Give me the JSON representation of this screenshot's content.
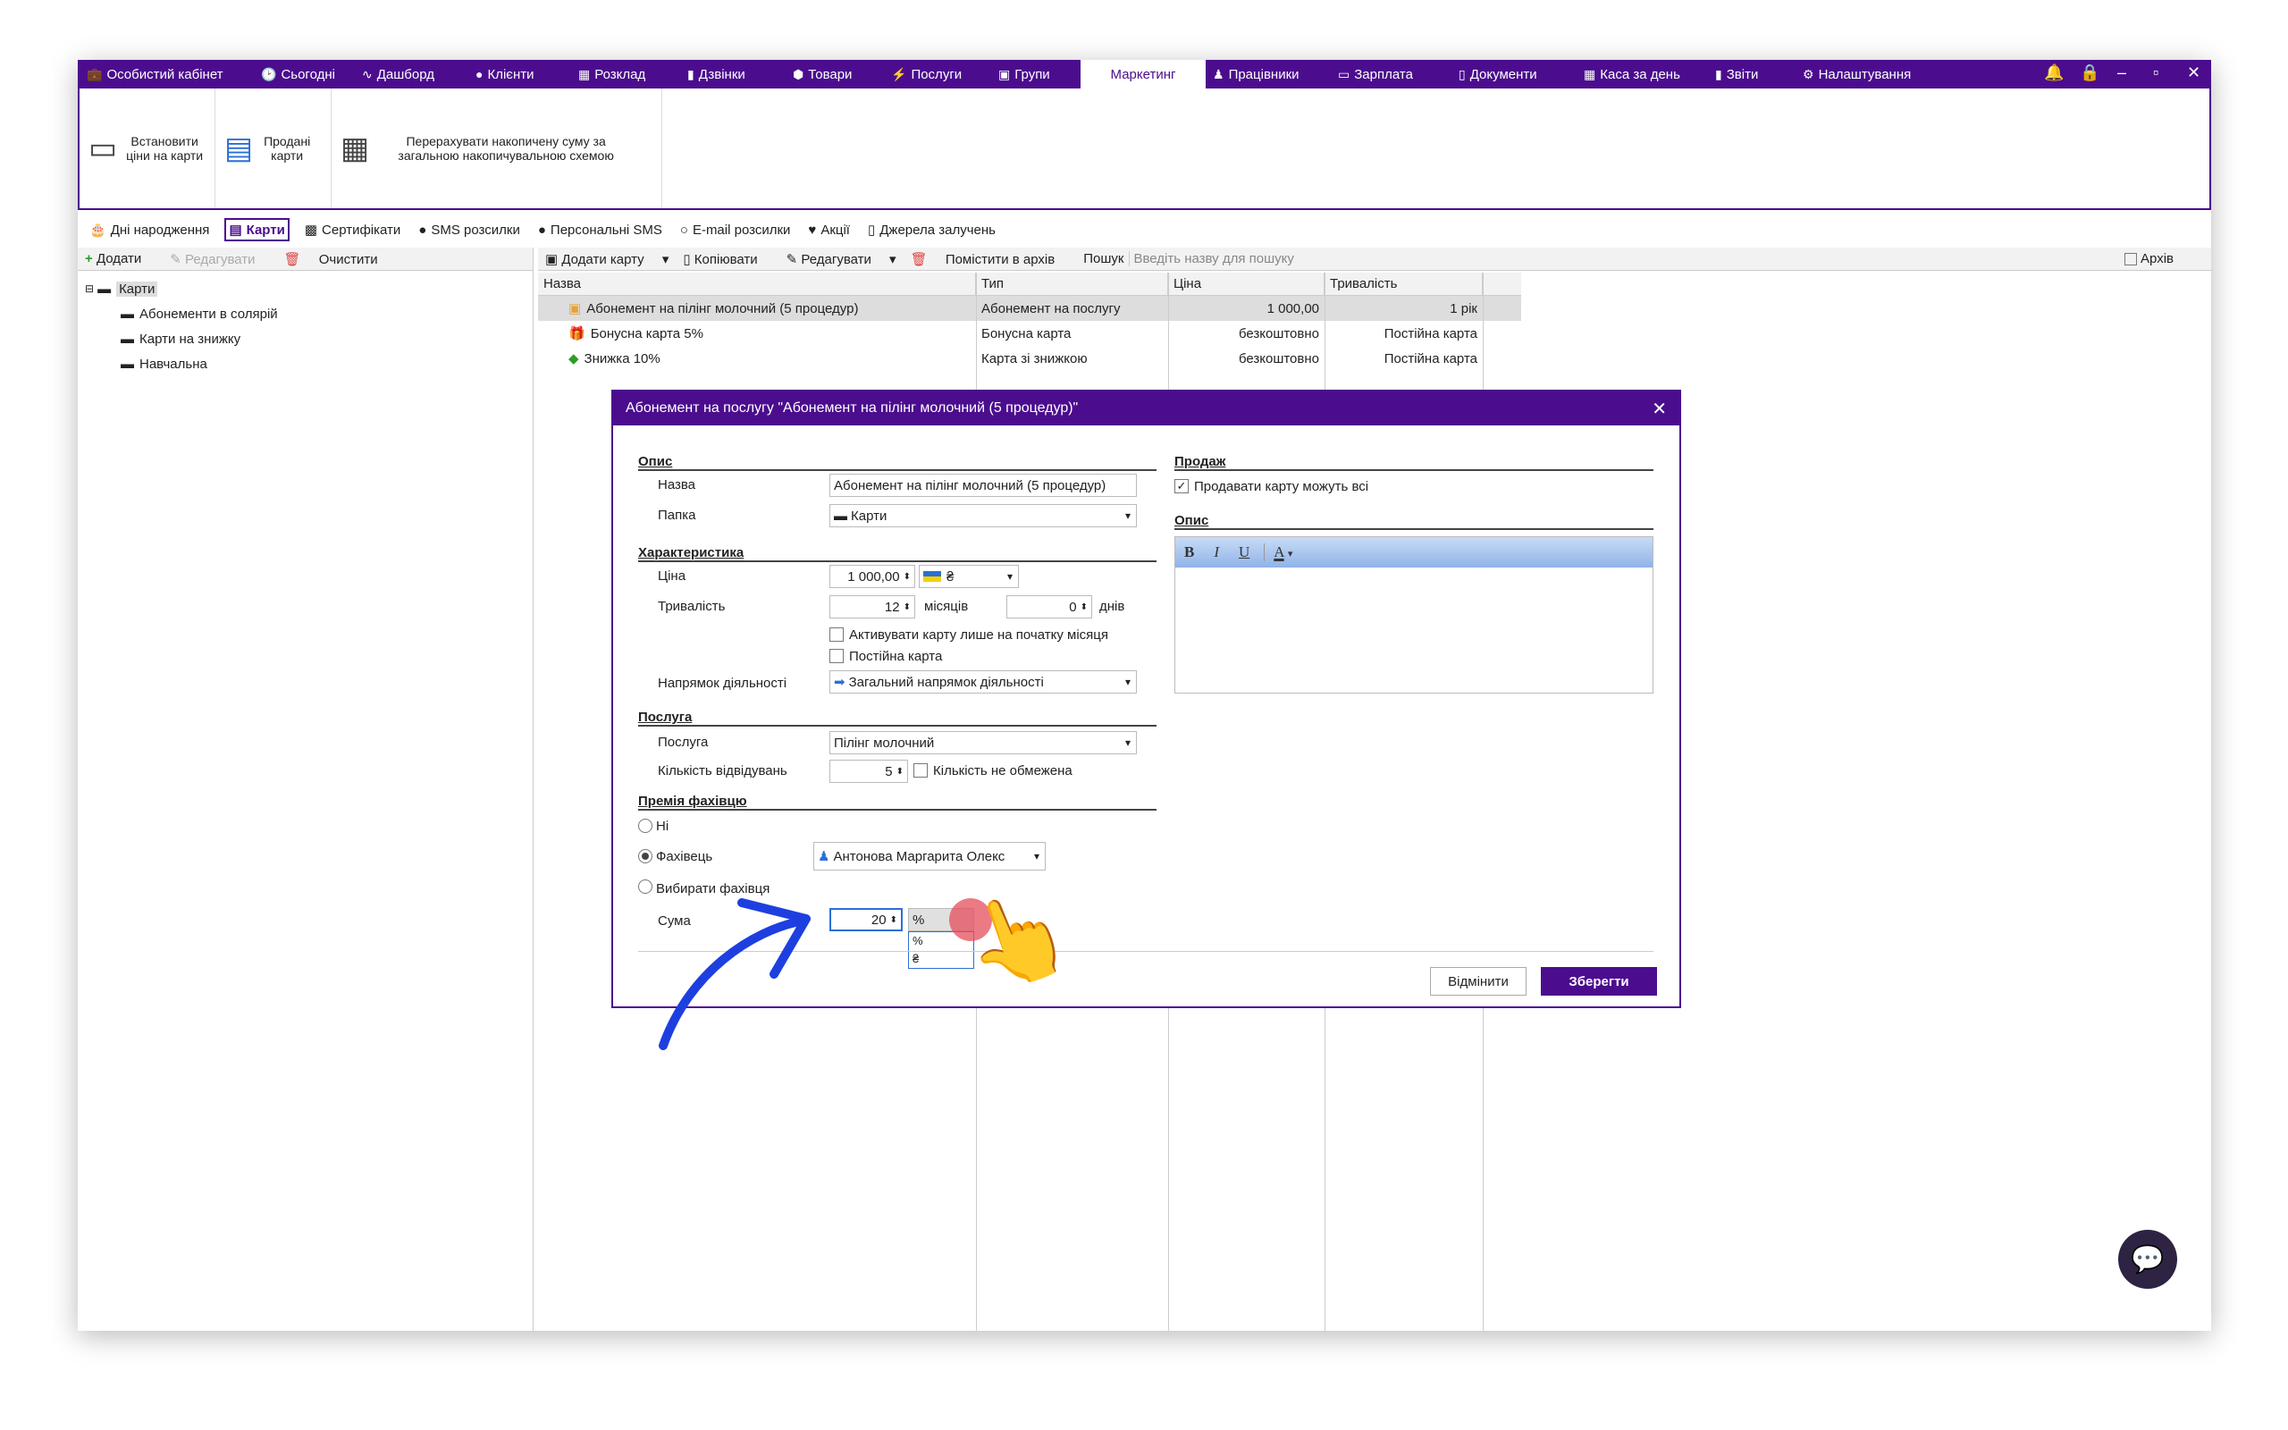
{
  "nav": {
    "items": [
      {
        "label": "Особистий кабінет",
        "icon": "briefcase-icon",
        "glyph": "💼"
      },
      {
        "label": "Сьогодні",
        "icon": "clock-icon",
        "glyph": "🕑"
      },
      {
        "label": "Дашборд",
        "icon": "pulse-icon",
        "glyph": "∿"
      },
      {
        "label": "Клієнти",
        "icon": "user-circle-icon",
        "glyph": "●"
      },
      {
        "label": "Розклад",
        "icon": "calendar-icon",
        "glyph": "▦"
      },
      {
        "label": "Дзвінки",
        "icon": "phone-icon",
        "glyph": "▮"
      },
      {
        "label": "Товари",
        "icon": "box-icon",
        "glyph": "⬢"
      },
      {
        "label": "Послуги",
        "icon": "bolt-icon",
        "glyph": "⚡"
      },
      {
        "label": "Групи",
        "icon": "group-icon",
        "glyph": "▣"
      },
      {
        "label": "Маркетинг",
        "icon": "",
        "glyph": ""
      },
      {
        "label": "Працівники",
        "icon": "person-icon",
        "glyph": "♟"
      },
      {
        "label": "Зарплата",
        "icon": "money-icon",
        "glyph": "▭"
      },
      {
        "label": "Документи",
        "icon": "document-icon",
        "glyph": "▯"
      },
      {
        "label": "Каса за день",
        "icon": "calculator-icon",
        "glyph": "▦"
      },
      {
        "label": "Звіти",
        "icon": "bar-chart-icon",
        "glyph": "▮"
      },
      {
        "label": "Налаштування",
        "icon": "gear-icon",
        "glyph": "⚙"
      }
    ],
    "active": "Маркетинг"
  },
  "ribbon": {
    "set_prices": "Встановити ціни на карти",
    "sold_cards": "Продані карти",
    "recalc": "Перерахувати накопичену суму за загальною накопичувальною схемою"
  },
  "subtabs": [
    {
      "label": "Дні народження",
      "glyph": "🎂"
    },
    {
      "label": "Карти",
      "glyph": "▤"
    },
    {
      "label": "Сертифікати",
      "glyph": "▩"
    },
    {
      "label": "SMS розсилки",
      "glyph": "●"
    },
    {
      "label": "Персональні SMS",
      "glyph": "●"
    },
    {
      "label": "E-mail розсилки",
      "glyph": "○"
    },
    {
      "label": "Акції",
      "glyph": "♥"
    },
    {
      "label": "Джерела залучень",
      "glyph": "▯"
    }
  ],
  "left_toolbar": {
    "add": "Додати",
    "edit": "Редагувати",
    "clear": "Очистити"
  },
  "tree": {
    "root": "Карти",
    "children": [
      "Абонементи в солярій",
      "Карти на знижку",
      "Навчальна"
    ]
  },
  "right_toolbar": {
    "add_card": "Додати карту",
    "copy": "Копіювати",
    "edit": "Редагувати",
    "archive": "Помістити в архів",
    "search_label": "Пошук",
    "search_placeholder": "Введіть назву для пошуку",
    "archive_check": "Архів"
  },
  "grid": {
    "headers": [
      "Назва",
      "Тип",
      "Ціна",
      "Тривалість"
    ],
    "rows": [
      [
        "Абонемент на пілінг молочний (5 процедур)",
        "Абонемент на послугу",
        "1 000,00",
        "1 рік"
      ],
      [
        "Бонусна карта 5%",
        "Бонусна карта",
        "безкоштовно",
        "Постійна карта"
      ],
      [
        "Знижка 10%",
        "Карта зі знижкою",
        "безкоштовно",
        "Постійна карта"
      ]
    ]
  },
  "dialog": {
    "title": "Абонемент на послугу \"Абонемент на пілінг молочний (5 процедур)\"",
    "s_desc": "Опис",
    "name_lbl": "Назва",
    "name_val": "Абонемент на пілінг молочний (5 процедур)",
    "folder_lbl": "Папка",
    "folder_val": "Карти",
    "s_char": "Характеристика",
    "price_lbl": "Ціна",
    "price_val": "1 000,00",
    "currency": "₴",
    "dur_lbl": "Тривалість",
    "months_val": "12",
    "months_unit": "місяців",
    "days_val": "0",
    "days_unit": "днів",
    "activate_cb": "Активувати карту лише на початку місяця",
    "permanent_cb": "Постійна карта",
    "dir_lbl": "Напрямок діяльності",
    "dir_val": "Загальний напрямок діяльності",
    "s_service": "Послуга",
    "service_lbl": "Послуга",
    "service_val": "Пілінг молочний",
    "visits_lbl": "Кількість відвідувань",
    "visits_val": "5",
    "unlimited_cb": "Кількість не обмежена",
    "s_bonus": "Премія фахівцю",
    "r_none": "Ні",
    "r_spec": "Фахівець",
    "spec_val": "Антонова Маргарита Олекс",
    "r_choose": "Вибирати фахівця",
    "sum_lbl": "Сума",
    "sum_val": "20",
    "unit_val": "%",
    "unit_opts": [
      "%",
      "₴"
    ],
    "s_sale": "Продаж",
    "sell_all_cb": "Продавати карту можуть всі",
    "s_desc2": "Опис",
    "fmt_b": "B",
    "fmt_i": "I",
    "fmt_u": "U",
    "fmt_a": "A",
    "cancel": "Відмінити",
    "save": "Зберегти"
  },
  "colors": {
    "accent": "#4b0d8e",
    "arrow": "#1e3fe0"
  }
}
